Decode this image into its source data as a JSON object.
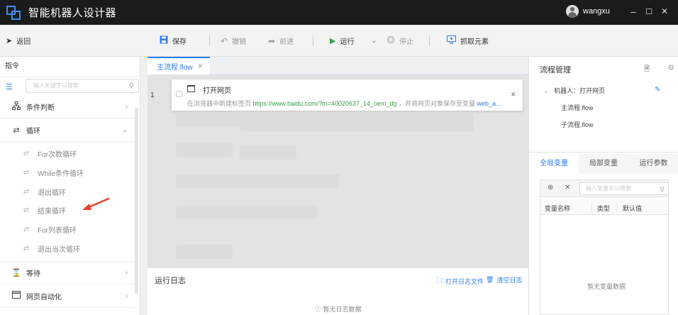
{
  "app": {
    "title": "智能机器人设计器",
    "username": "wangxu",
    "window_controls": [
      "–",
      "☐",
      "✕"
    ]
  },
  "toolbar": {
    "back": "返回",
    "save": "保存",
    "undo": "撤销",
    "redo": "前进",
    "run": "运行",
    "stop": "停止",
    "capture": "抓取元素"
  },
  "left_panel": {
    "header": "指令",
    "search_placeholder": "输入关键字以搜索",
    "categories": [
      {
        "label": "条件判断",
        "icon": "branch-icon",
        "expanded": false
      },
      {
        "label": "循环",
        "icon": "loop-icon",
        "expanded": true
      },
      {
        "label": "等待",
        "icon": "hourglass-icon",
        "expanded": false
      },
      {
        "label": "网页自动化",
        "icon": "browser-icon",
        "expanded": false
      }
    ],
    "loop_items": [
      "For次数循环",
      "While条件循环",
      "退出循环",
      "结束循环",
      "For列表循环",
      "退出当次循环"
    ]
  },
  "editor": {
    "tab_label": "主流程.flow",
    "step": {
      "line": "1",
      "title": "打开网页",
      "desc_prefix": "在浏览器中新建标签页",
      "desc_url": "https://www.baidu.com/?tn=40020637_14_oem_dg",
      "desc_mid": "，并将网页对象保存至变量",
      "desc_var": "web_a..."
    }
  },
  "log": {
    "title": "运行日志",
    "open_file": "打开日志文件",
    "clear": "清空日志",
    "empty": "暂无日志数据"
  },
  "right_panel": {
    "title": "流程管理",
    "tree_root": "机器人：打开网页",
    "tree_children": [
      "主流程.flow",
      "子流程.flow"
    ],
    "tabs": [
      "全局变量",
      "局部变量",
      "运行参数"
    ],
    "search_placeholder": "输入变量名以搜索",
    "columns": [
      "变量名称",
      "类型",
      "默认值"
    ],
    "empty": "暂无变量数据"
  },
  "colors": {
    "accent": "#2b7de9",
    "titlebar": "#1b1b1b",
    "url_green": "#3aa04a",
    "run_green": "#3aa04a",
    "arrow_red": "#e8412c"
  }
}
